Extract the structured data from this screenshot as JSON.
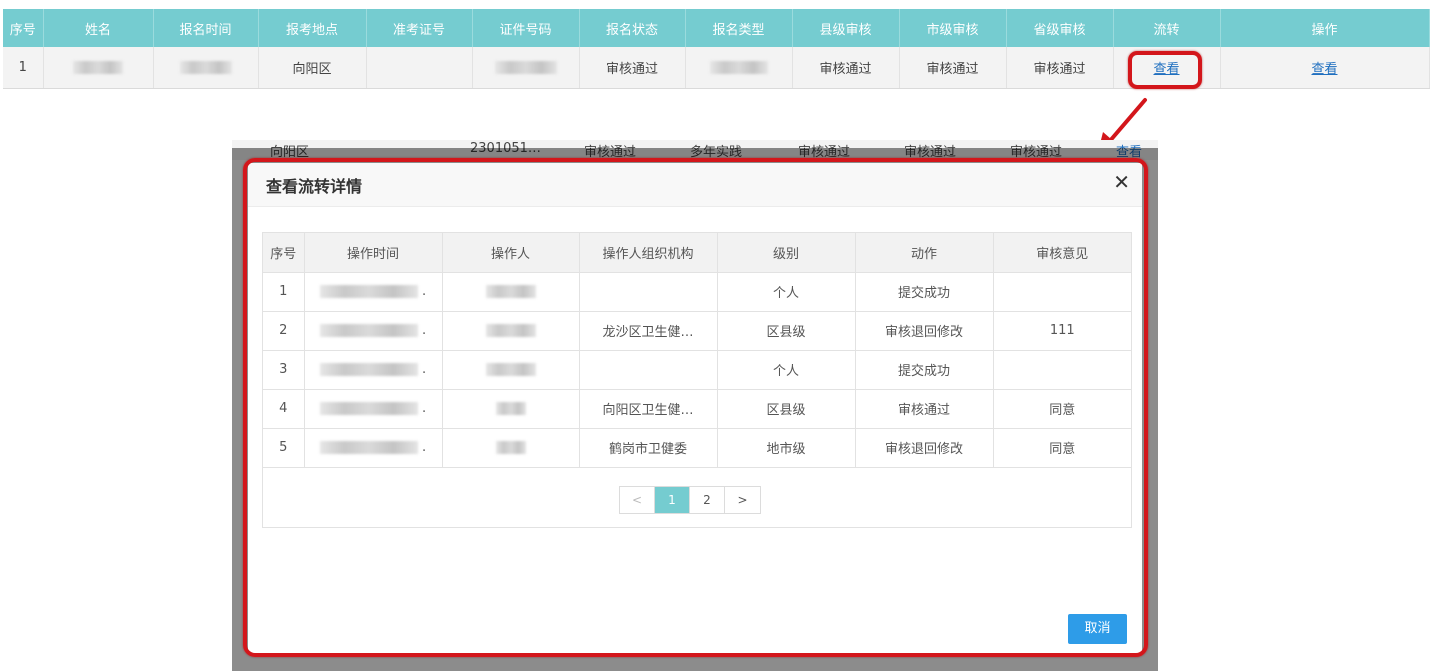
{
  "top_table": {
    "headers": [
      "序号",
      "姓名",
      "报名时间",
      "报考地点",
      "准考证号",
      "证件号码",
      "报名状态",
      "报名类型",
      "县级审核",
      "市级审核",
      "省级审核",
      "流转",
      "操作"
    ],
    "row": {
      "index": "1",
      "location": "向阳区",
      "status": "审核通过",
      "county_review": "审核通过",
      "city_review": "审核通过",
      "province_review": "审核通过",
      "flow_link": "查看",
      "action_link": "查看"
    }
  },
  "background_row": {
    "location": "向阳区",
    "id_prefix": "2301051…",
    "status": "审核通过",
    "type": "多年实践",
    "county_review": "审核通过",
    "city_review": "审核通过",
    "province_review": "审核通过",
    "link": "查看"
  },
  "modal": {
    "title": "查看流转详情",
    "close_icon": "close-icon",
    "columns": [
      "序号",
      "操作时间",
      "操作人",
      "操作人组织机构",
      "级别",
      "动作",
      "审核意见"
    ],
    "rows": [
      {
        "index": "1",
        "org": "",
        "level": "个人",
        "action": "提交成功",
        "opinion": ""
      },
      {
        "index": "2",
        "org": "龙沙区卫生健…",
        "level": "区县级",
        "action": "审核退回修改",
        "opinion": "111"
      },
      {
        "index": "3",
        "org": "",
        "level": "个人",
        "action": "提交成功",
        "opinion": ""
      },
      {
        "index": "4",
        "org": "向阳区卫生健…",
        "level": "区县级",
        "action": "审核通过",
        "opinion": "同意"
      },
      {
        "index": "5",
        "org": "鹤岗市卫健委",
        "level": "地市级",
        "action": "审核退回修改",
        "opinion": "同意"
      }
    ],
    "pagination": {
      "prev": "<",
      "pages": [
        "1",
        "2"
      ],
      "current": "1",
      "next": ">"
    },
    "cancel_label": "取消"
  },
  "colors": {
    "header_teal": "#75ccd0",
    "highlight_red": "#d3161b",
    "primary_blue": "#2e9ce8",
    "link_blue": "#1f6fbf"
  }
}
